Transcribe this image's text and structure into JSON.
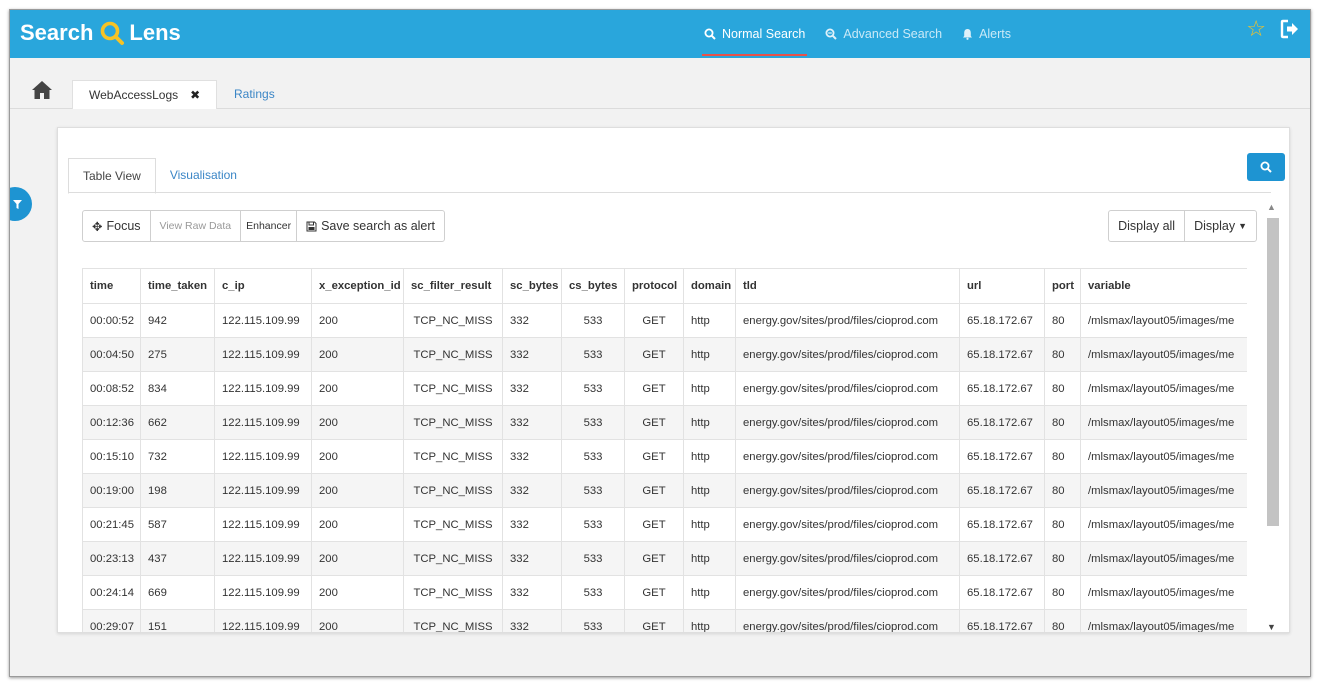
{
  "app": {
    "brand_left": "Search",
    "brand_right": "Lens",
    "colors": {
      "header": "#29a6dc",
      "accent": "#1e94d2",
      "star": "#f6c325",
      "active_underline": "#e8524a"
    }
  },
  "nav": {
    "items": [
      {
        "label": "Normal Search",
        "icon": "search-icon"
      },
      {
        "label": "Advanced Search",
        "icon": "zoom-search-icon"
      },
      {
        "label": "Alerts",
        "icon": "bell-icon"
      }
    ],
    "active": "Normal Search"
  },
  "tabs": {
    "items": [
      {
        "label": "WebAccessLogs",
        "closable": true
      },
      {
        "label": "Ratings",
        "closable": false
      }
    ]
  },
  "view_tabs": [
    {
      "label": "Table View"
    },
    {
      "label": "Visualisation"
    }
  ],
  "toolbar": {
    "focus": "Focus",
    "view_raw": "View Raw Data",
    "enhancer": "Enhancer",
    "save_alert": "Save search as alert",
    "display_all": "Display all",
    "display": "Display"
  },
  "table": {
    "columns": [
      "time",
      "time_taken",
      "c_ip",
      "x_exception_id",
      "sc_filter_result",
      "sc_bytes",
      "cs_bytes",
      "protocol",
      "domain",
      "tld",
      "url",
      "port",
      "variable"
    ],
    "rows": [
      [
        "00:00:52",
        "942",
        "122.115.109.99",
        "200",
        "TCP_NC_MISS",
        "332",
        "533",
        "GET",
        "http",
        "energy.gov/sites/prod/files/cioprod.com",
        "65.18.172.67",
        "80",
        "/mlsmax/layout05/images/me"
      ],
      [
        "00:04:50",
        "275",
        "122.115.109.99",
        "200",
        "TCP_NC_MISS",
        "332",
        "533",
        "GET",
        "http",
        "energy.gov/sites/prod/files/cioprod.com",
        "65.18.172.67",
        "80",
        "/mlsmax/layout05/images/me"
      ],
      [
        "00:08:52",
        "834",
        "122.115.109.99",
        "200",
        "TCP_NC_MISS",
        "332",
        "533",
        "GET",
        "http",
        "energy.gov/sites/prod/files/cioprod.com",
        "65.18.172.67",
        "80",
        "/mlsmax/layout05/images/me"
      ],
      [
        "00:12:36",
        "662",
        "122.115.109.99",
        "200",
        "TCP_NC_MISS",
        "332",
        "533",
        "GET",
        "http",
        "energy.gov/sites/prod/files/cioprod.com",
        "65.18.172.67",
        "80",
        "/mlsmax/layout05/images/me"
      ],
      [
        "00:15:10",
        "732",
        "122.115.109.99",
        "200",
        "TCP_NC_MISS",
        "332",
        "533",
        "GET",
        "http",
        "energy.gov/sites/prod/files/cioprod.com",
        "65.18.172.67",
        "80",
        "/mlsmax/layout05/images/me"
      ],
      [
        "00:19:00",
        "198",
        "122.115.109.99",
        "200",
        "TCP_NC_MISS",
        "332",
        "533",
        "GET",
        "http",
        "energy.gov/sites/prod/files/cioprod.com",
        "65.18.172.67",
        "80",
        "/mlsmax/layout05/images/me"
      ],
      [
        "00:21:45",
        "587",
        "122.115.109.99",
        "200",
        "TCP_NC_MISS",
        "332",
        "533",
        "GET",
        "http",
        "energy.gov/sites/prod/files/cioprod.com",
        "65.18.172.67",
        "80",
        "/mlsmax/layout05/images/me"
      ],
      [
        "00:23:13",
        "437",
        "122.115.109.99",
        "200",
        "TCP_NC_MISS",
        "332",
        "533",
        "GET",
        "http",
        "energy.gov/sites/prod/files/cioprod.com",
        "65.18.172.67",
        "80",
        "/mlsmax/layout05/images/me"
      ],
      [
        "00:24:14",
        "669",
        "122.115.109.99",
        "200",
        "TCP_NC_MISS",
        "332",
        "533",
        "GET",
        "http",
        "energy.gov/sites/prod/files/cioprod.com",
        "65.18.172.67",
        "80",
        "/mlsmax/layout05/images/me"
      ],
      [
        "00:29:07",
        "151",
        "122.115.109.99",
        "200",
        "TCP_NC_MISS",
        "332",
        "533",
        "GET",
        "http",
        "energy.gov/sites/prod/files/cioprod.com",
        "65.18.172.67",
        "80",
        "/mlsmax/layout05/images/me"
      ]
    ]
  }
}
